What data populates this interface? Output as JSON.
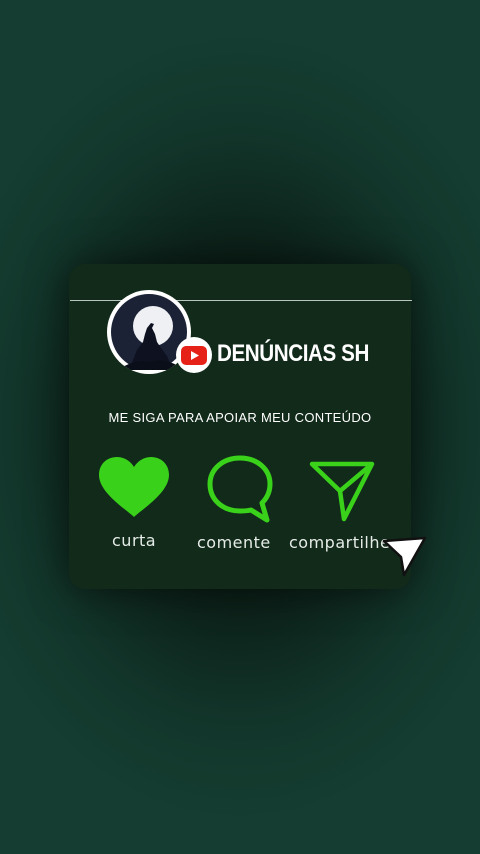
{
  "profile": {
    "channel_name": "DENÚNCIAS SH",
    "avatar_icon": "howling-wolf-moon-icon",
    "platform_icon": "youtube-icon"
  },
  "prompt_text": "ME SIGA PARA APOIAR MEU CONTEÚDO",
  "actions": [
    {
      "label": "curta",
      "icon": "heart-icon"
    },
    {
      "label": "comente",
      "icon": "speech-bubble-icon"
    },
    {
      "label": "compartilhe",
      "icon": "send-icon"
    }
  ],
  "colors": {
    "accent_green": "#3ad11a",
    "card_bg": "#112a1a",
    "youtube_red": "#e62117"
  }
}
